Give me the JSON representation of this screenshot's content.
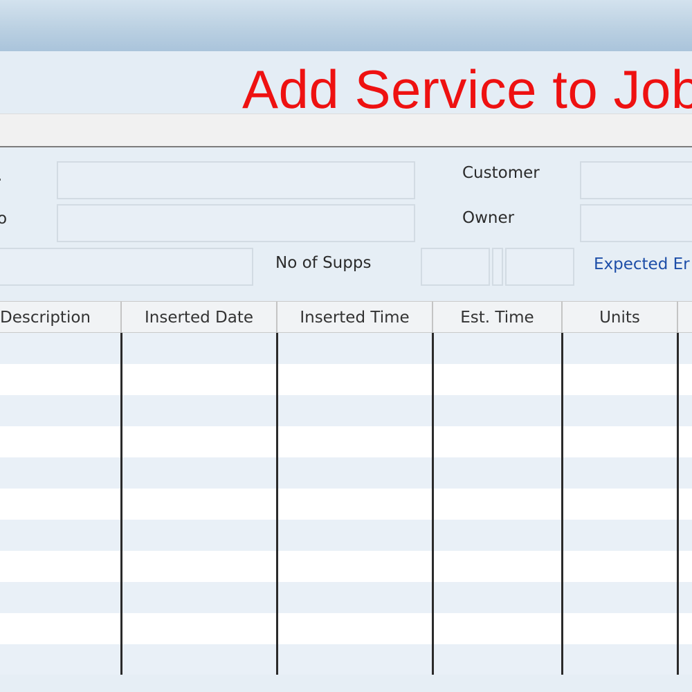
{
  "header": {
    "title": "Add Service to Job"
  },
  "form": {
    "label_top_left": ".",
    "label_second_left": "o",
    "customer_label": "Customer",
    "owner_label": "Owner",
    "no_of_supps_label": "No of Supps",
    "expected_label": "Expected Er",
    "fields": {
      "top_left_value": "",
      "second_left_value": "",
      "customer_value": "",
      "owner_value": "",
      "third_left_value": "",
      "supps_value_1": "",
      "supps_value_2": ""
    }
  },
  "grid": {
    "columns": [
      "Description",
      "Inserted  Date",
      "Inserted Time",
      "Est. Time",
      "Units",
      ""
    ],
    "rows": [
      "",
      "",
      "",
      "",
      "",
      "",
      "",
      "",
      "",
      "",
      ""
    ]
  },
  "colors": {
    "title": "#ee1111",
    "link": "#1d4ea8",
    "row_alt": "#e9f0f7"
  }
}
